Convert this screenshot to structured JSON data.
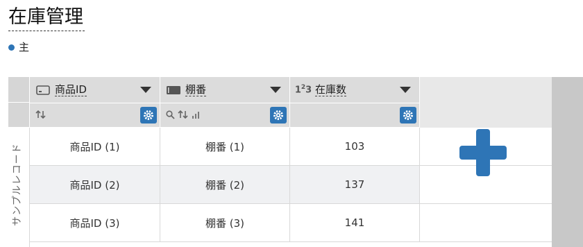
{
  "page": {
    "title": "在庫管理",
    "subtitle": "主",
    "accent_color": "#2e75b6"
  },
  "table": {
    "row_header_label": "サンプルレコード",
    "columns": [
      {
        "label": "商品ID",
        "type_icon": "id-card-icon",
        "bottom_icons": [
          "sort-icon"
        ]
      },
      {
        "label": "棚番",
        "type_icon": "text-field-icon",
        "bottom_icons": [
          "search-icon",
          "sort-icon",
          "bar-chart-icon"
        ]
      },
      {
        "label": "在庫数",
        "type_icon": "number-icon",
        "type_icon_text": "1²3",
        "bottom_icons": []
      }
    ],
    "rows": [
      [
        "商品ID (1)",
        "棚番 (1)",
        "103"
      ],
      [
        "商品ID (2)",
        "棚番 (2)",
        "137"
      ],
      [
        "商品ID (3)",
        "棚番 (3)",
        "141"
      ]
    ]
  }
}
